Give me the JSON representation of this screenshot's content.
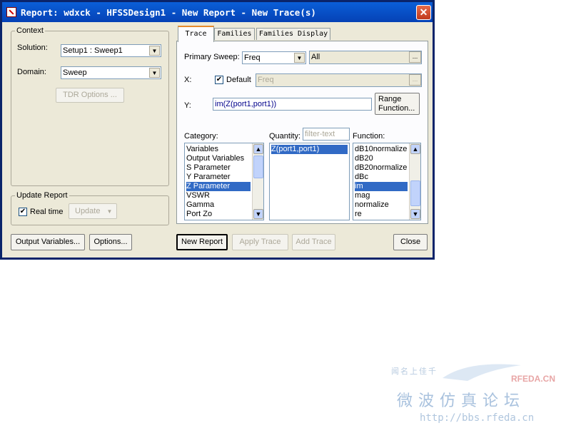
{
  "window": {
    "title": "Report: wdxck - HFSSDesign1 - New Report - New Trace(s)",
    "close_glyph": "✕"
  },
  "context": {
    "legend": "Context",
    "solution_label": "Solution:",
    "solution_value": "Setup1 : Sweep1",
    "domain_label": "Domain:",
    "domain_value": "Sweep",
    "tdr_options": "TDR Options ..."
  },
  "update_report": {
    "legend": "Update Report",
    "real_time_label": "Real time",
    "real_time_checked": true,
    "update_button": "Update"
  },
  "tabs": [
    {
      "label": "Trace",
      "active": true
    },
    {
      "label": "Families",
      "active": false
    },
    {
      "label": "Families Display",
      "active": false
    }
  ],
  "trace": {
    "primary_sweep_label": "Primary Sweep:",
    "primary_sweep_value": "Freq",
    "primary_sweep_range": "All",
    "ellipsis": "...",
    "x_label": "X:",
    "default_label": "Default",
    "default_checked": true,
    "x_value": "Freq",
    "y_label": "Y:",
    "y_value": "im(Z(port1,port1))",
    "range_function_line1": "Range",
    "range_function_line2": "Function...",
    "category_label": "Category:",
    "quantity_label": "Quantity:",
    "quantity_filter_placeholder": "filter-text",
    "function_label": "Function:",
    "categories": [
      "Variables",
      "Output Variables",
      "S Parameter",
      "Y Parameter",
      "Z Parameter",
      "VSWR",
      "Gamma",
      "Port Zo"
    ],
    "selected_category": "Z Parameter",
    "quantities": [
      "Z(port1,port1)"
    ],
    "selected_quantity": "Z(port1,port1)",
    "functions": [
      "dB10normalize",
      "dB20",
      "dB20normalize",
      "dBc",
      "im",
      "mag",
      "normalize",
      "re"
    ],
    "selected_function": "im"
  },
  "bottom_buttons": {
    "output_variables": "Output Variables...",
    "options": "Options...",
    "new_report": "New Report",
    "apply_trace": "Apply Trace",
    "add_trace": "Add Trace",
    "close": "Close"
  },
  "watermark": {
    "line1": "闻名上佳千",
    "brand": "RFEDA.CN",
    "chinese": "微波仿真论坛",
    "url": "http://bbs.rfeda.cn"
  },
  "colors": {
    "title_bar": "#0a5fd8",
    "selection": "#316ac5",
    "dialog_bg": "#ece9d8"
  }
}
